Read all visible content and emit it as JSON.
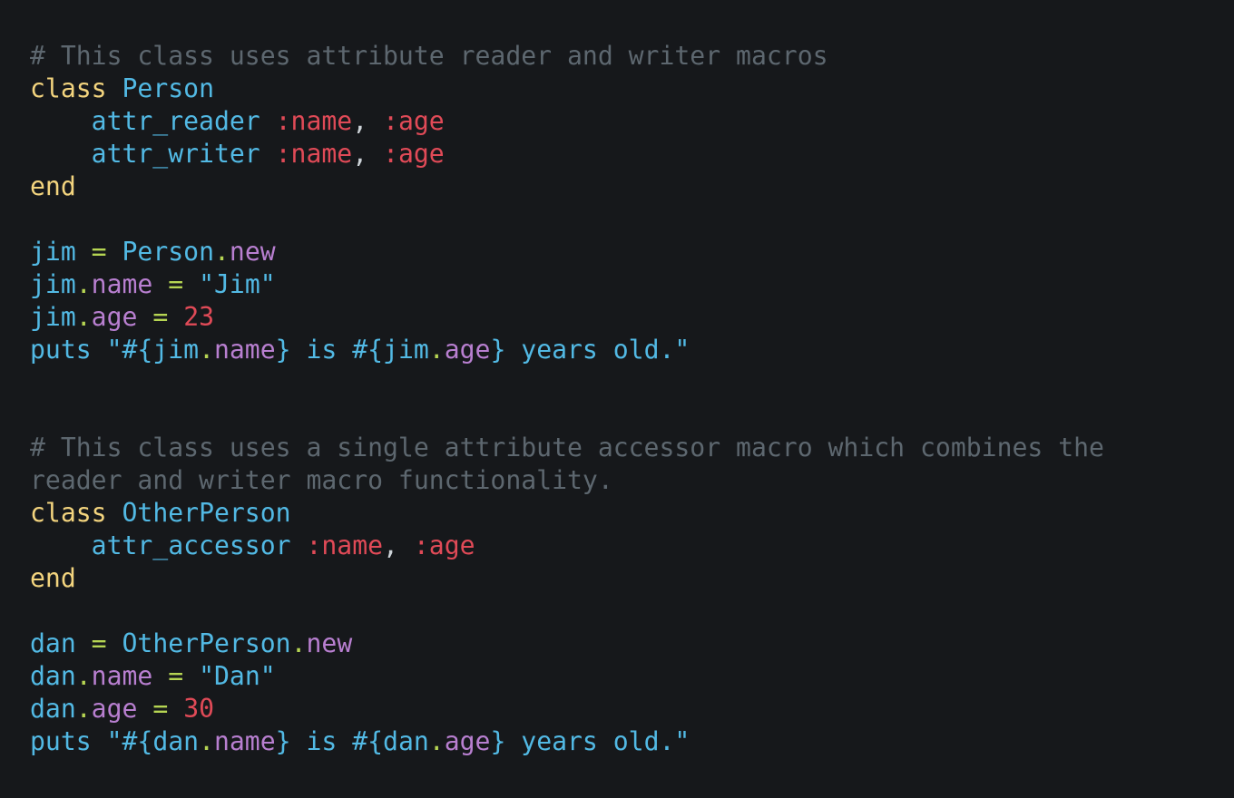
{
  "colors": {
    "background": "#16181b",
    "comment": "#5d676f",
    "keyword": "#f3d47e",
    "identifier": "#52b9e4",
    "symbol": "#e04a57",
    "number": "#e04a57",
    "punctuation": "#cdd3d8",
    "operator": "#b6d553",
    "method": "#b87fd0"
  },
  "lines": [
    [
      {
        "t": "comment",
        "v": "# This class uses attribute reader and writer macros"
      }
    ],
    [
      {
        "t": "keyword",
        "v": "class"
      },
      {
        "t": "ws",
        "v": " "
      },
      {
        "t": "class",
        "v": "Person"
      }
    ],
    [
      {
        "t": "ws",
        "v": "    "
      },
      {
        "t": "ident",
        "v": "attr_reader"
      },
      {
        "t": "ws",
        "v": " "
      },
      {
        "t": "symbol",
        "v": ":name"
      },
      {
        "t": "punct",
        "v": ","
      },
      {
        "t": "ws",
        "v": " "
      },
      {
        "t": "symbol",
        "v": ":age"
      }
    ],
    [
      {
        "t": "ws",
        "v": "    "
      },
      {
        "t": "ident",
        "v": "attr_writer"
      },
      {
        "t": "ws",
        "v": " "
      },
      {
        "t": "symbol",
        "v": ":name"
      },
      {
        "t": "punct",
        "v": ","
      },
      {
        "t": "ws",
        "v": " "
      },
      {
        "t": "symbol",
        "v": ":age"
      }
    ],
    [
      {
        "t": "keyword",
        "v": "end"
      }
    ],
    [],
    [
      {
        "t": "ident",
        "v": "jim"
      },
      {
        "t": "ws",
        "v": " "
      },
      {
        "t": "op",
        "v": "="
      },
      {
        "t": "ws",
        "v": " "
      },
      {
        "t": "class",
        "v": "Person"
      },
      {
        "t": "dot",
        "v": "."
      },
      {
        "t": "method",
        "v": "new"
      }
    ],
    [
      {
        "t": "ident",
        "v": "jim"
      },
      {
        "t": "dot",
        "v": "."
      },
      {
        "t": "method",
        "v": "name"
      },
      {
        "t": "ws",
        "v": " "
      },
      {
        "t": "op",
        "v": "="
      },
      {
        "t": "ws",
        "v": " "
      },
      {
        "t": "string",
        "v": "\"Jim\""
      }
    ],
    [
      {
        "t": "ident",
        "v": "jim"
      },
      {
        "t": "dot",
        "v": "."
      },
      {
        "t": "method",
        "v": "age"
      },
      {
        "t": "ws",
        "v": " "
      },
      {
        "t": "op",
        "v": "="
      },
      {
        "t": "ws",
        "v": " "
      },
      {
        "t": "number",
        "v": "23"
      }
    ],
    [
      {
        "t": "ident",
        "v": "puts"
      },
      {
        "t": "ws",
        "v": " "
      },
      {
        "t": "string",
        "v": "\"#{jim"
      },
      {
        "t": "dot",
        "v": "."
      },
      {
        "t": "method",
        "v": "name"
      },
      {
        "t": "string",
        "v": "} is #{jim"
      },
      {
        "t": "dot",
        "v": "."
      },
      {
        "t": "method",
        "v": "age"
      },
      {
        "t": "string",
        "v": "} years old.\""
      }
    ],
    [],
    [],
    [
      {
        "t": "comment",
        "v": "# This class uses a single attribute accessor macro which combines the"
      }
    ],
    [
      {
        "t": "comment",
        "v": "reader and writer macro functionality."
      }
    ],
    [
      {
        "t": "keyword",
        "v": "class"
      },
      {
        "t": "ws",
        "v": " "
      },
      {
        "t": "class",
        "v": "OtherPerson"
      }
    ],
    [
      {
        "t": "ws",
        "v": "    "
      },
      {
        "t": "ident",
        "v": "attr_accessor"
      },
      {
        "t": "ws",
        "v": " "
      },
      {
        "t": "symbol",
        "v": ":name"
      },
      {
        "t": "punct",
        "v": ","
      },
      {
        "t": "ws",
        "v": " "
      },
      {
        "t": "symbol",
        "v": ":age"
      }
    ],
    [
      {
        "t": "keyword",
        "v": "end"
      }
    ],
    [],
    [
      {
        "t": "ident",
        "v": "dan"
      },
      {
        "t": "ws",
        "v": " "
      },
      {
        "t": "op",
        "v": "="
      },
      {
        "t": "ws",
        "v": " "
      },
      {
        "t": "class",
        "v": "OtherPerson"
      },
      {
        "t": "dot",
        "v": "."
      },
      {
        "t": "method",
        "v": "new"
      }
    ],
    [
      {
        "t": "ident",
        "v": "dan"
      },
      {
        "t": "dot",
        "v": "."
      },
      {
        "t": "method",
        "v": "name"
      },
      {
        "t": "ws",
        "v": " "
      },
      {
        "t": "op",
        "v": "="
      },
      {
        "t": "ws",
        "v": " "
      },
      {
        "t": "string",
        "v": "\"Dan\""
      }
    ],
    [
      {
        "t": "ident",
        "v": "dan"
      },
      {
        "t": "dot",
        "v": "."
      },
      {
        "t": "method",
        "v": "age"
      },
      {
        "t": "ws",
        "v": " "
      },
      {
        "t": "op",
        "v": "="
      },
      {
        "t": "ws",
        "v": " "
      },
      {
        "t": "number",
        "v": "30"
      }
    ],
    [
      {
        "t": "ident",
        "v": "puts"
      },
      {
        "t": "ws",
        "v": " "
      },
      {
        "t": "string",
        "v": "\"#{dan"
      },
      {
        "t": "dot",
        "v": "."
      },
      {
        "t": "method",
        "v": "name"
      },
      {
        "t": "string",
        "v": "} is #{dan"
      },
      {
        "t": "dot",
        "v": "."
      },
      {
        "t": "method",
        "v": "age"
      },
      {
        "t": "string",
        "v": "} years old.\""
      }
    ]
  ]
}
